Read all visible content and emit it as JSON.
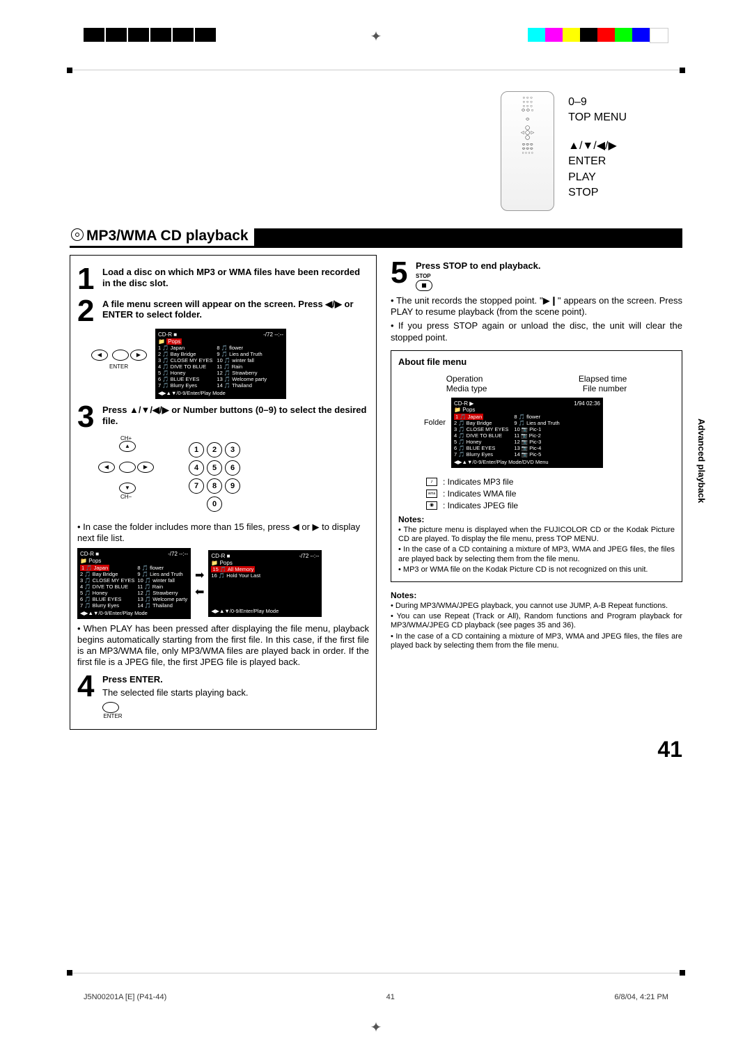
{
  "section_title": "MP3/WMA CD playback",
  "remote_labels": {
    "nums": "0–9",
    "top_menu": "TOP MENU",
    "nav": "▲/▼/◀/▶",
    "enter": "ENTER",
    "play": "PLAY",
    "stop": "STOP"
  },
  "steps": {
    "s1": "Load a disc on which MP3 or WMA files have been recorded in the disc slot.",
    "s2": "A file menu screen will appear on the screen. Press ◀/▶ or ENTER to select folder.",
    "s3": "Press ▲/▼/◀/▶ or Number buttons (0–9) to select the desired file.",
    "s4_title": "Press ENTER.",
    "s4_body": "The selected file starts playing back.",
    "s5_title": "Press STOP to end playback.",
    "s5_label": "STOP"
  },
  "screen_a": {
    "header_left": "CD-R ■",
    "header_right": "-/72   --:--",
    "folder": "Pops",
    "items_left": [
      "1 🎵 Japan",
      "2 🎵 Bay Bridge",
      "3 🎵 CLOSE MY EYES",
      "4 🎵 DIVE TO BLUE",
      "5 🎵 Honey",
      "6 🎵 BLUE EYES",
      "7 🎵 Blurry Eyes"
    ],
    "items_right": [
      "8 🎵 flower",
      "9 🎵 Lies and Truth",
      "10 🎵 winter fall",
      "11 🎵 Rain",
      "12 🎵 Strawberry",
      "13 🎵 Welcome party",
      "14 🎵 Thailand"
    ],
    "footer": "◀▶▲▼/0-9/Enter/Play Mode"
  },
  "screen_b": {
    "header_left": "CD-R ■",
    "header_right": "-/72   --:--",
    "folder": "Pops",
    "items": [
      "15 🎵 All Memory",
      "16 🎵 Hold Your Last"
    ],
    "footer": "◀▶▲▼/0-9/Enter/Play Mode"
  },
  "screen_c": {
    "header_left": "CD-R ▶",
    "header_right": "1/94   02:36",
    "folder": "Pops",
    "items_left": [
      "1 🎵 Japan",
      "2 🎵 Bay Bridge",
      "3 🎵 CLOSE MY EYES",
      "4 🎵 DIVE TO BLUE",
      "5 🎵 Honey",
      "6 🎵 BLUE EYES",
      "7 🎵 Blurry Eyes"
    ],
    "items_right": [
      "8 🎵 flower",
      "9 🎵 Lies and Truth",
      "10 📷 Pic-1",
      "11 📷 Pic-2",
      "12 📷 Pic-3",
      "13 📷 Pic-4",
      "14 📷 Pic-5"
    ],
    "footer": "◀▶▲▼/0-9/Enter/Play Mode/DVD Menu"
  },
  "body": {
    "b3_note": "In case the folder includes more than 15 files, press ◀ or ▶ to display next file list.",
    "b3_play": "When PLAY has been pressed after displaying the file menu, playback begins automatically starting from the first file. In this case, if the first file is an MP3/WMA file, only MP3/WMA files are played back in order. If the first file is a JPEG file, the first JPEG file is played back.",
    "r_bullet1": "The unit records the stopped point. \"▶❙\" appears on the screen. Press PLAY to resume playback (from the scene point).",
    "r_bullet2": "If you press STOP again or unload the disc, the unit will clear the stopped point."
  },
  "about": {
    "title": "About file menu",
    "top_labels": {
      "op": "Operation",
      "et": "Elapsed time",
      "mt": "Media type",
      "fn": "File number",
      "fd": "Folder"
    },
    "ind_mp3": ": Indicates MP3 file",
    "ind_wma": ": Indicates WMA file",
    "ind_jpeg": ": Indicates JPEG file",
    "notes_title": "Notes:",
    "n1": "The picture menu is displayed when the FUJICOLOR CD or the Kodak Picture CD are played. To display the file menu, press TOP MENU.",
    "n2": "In the case of a CD containing a mixture of MP3, WMA and JPEG files, the files are played back by selecting them from the file menu.",
    "n3": "MP3 or WMA file on the Kodak Picture CD is not recognized on this unit."
  },
  "ext_notes": {
    "title": "Notes:",
    "n1": "During MP3/WMA/JPEG playback, you cannot use JUMP, A-B Repeat functions.",
    "n2": "You can use Repeat (Track or All), Random functions and Program playback for MP3/WMA/JPEG CD playback (see pages 35 and 36).",
    "n3": "In the case of a CD containing a mixture of MP3, WMA and JPEG files, the files are played back by selecting them from the file menu."
  },
  "side_tab": "Advanced playback",
  "page_number": "41",
  "footer": {
    "left": "J5N00201A [E] (P41-44)",
    "center": "41",
    "right": "6/8/04, 4:21 PM"
  },
  "enter_label": "ENTER",
  "ch_plus": "CH+",
  "ch_minus": "CH−"
}
